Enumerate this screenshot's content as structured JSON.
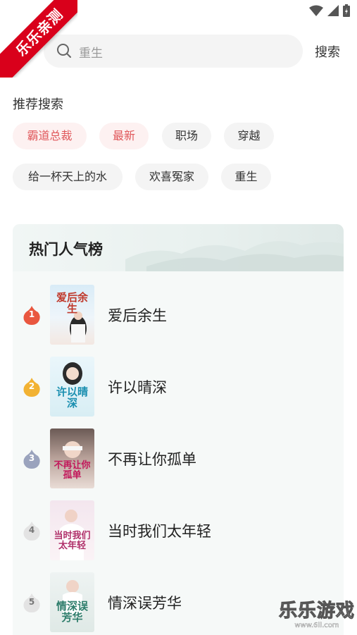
{
  "ribbon": {
    "text": "乐乐亲测"
  },
  "header": {
    "search_placeholder": "重生",
    "search_button": "搜索"
  },
  "recommend": {
    "title": "推荐搜索",
    "chips": [
      {
        "label": "霸道总裁",
        "hot": true
      },
      {
        "label": "最新",
        "hot": true
      },
      {
        "label": "职场",
        "hot": false
      },
      {
        "label": "穿越",
        "hot": false
      },
      {
        "label": "给一杯天上的水",
        "hot": false
      },
      {
        "label": "欢喜冤家",
        "hot": false
      },
      {
        "label": "重生",
        "hot": false
      }
    ]
  },
  "ranking": {
    "title": "热门人气榜",
    "items": [
      {
        "rank": "1",
        "name": "爱后余生",
        "cover_title": "爱后余生",
        "medal_color": "#e9573f"
      },
      {
        "rank": "2",
        "name": "许以晴深",
        "cover_title": "许以晴深",
        "medal_color": "#f2b233"
      },
      {
        "rank": "3",
        "name": "不再让你孤单",
        "cover_title": "不再让你孤单",
        "medal_color": "#9aa3bd"
      },
      {
        "rank": "4",
        "name": "当时我们太年轻",
        "cover_title": "当时我们太年轻",
        "medal_color": "#e3e3e3"
      },
      {
        "rank": "5",
        "name": "情深误芳华",
        "cover_title": "情深误芳华",
        "medal_color": "#e3e3e3"
      }
    ]
  },
  "watermark": {
    "text": "乐乐游戏",
    "url": "www.6ll.com"
  },
  "colors": {
    "accent": "#e0575a",
    "chip_hot_bg": "#fdf1f1",
    "chip_bg": "#f4f4f4",
    "ribbon": "#d9001b"
  }
}
